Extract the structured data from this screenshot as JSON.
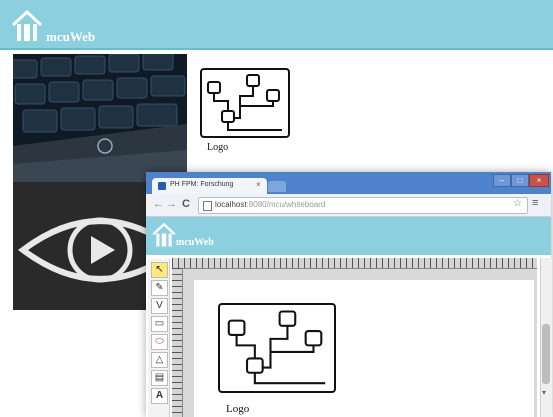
{
  "app": {
    "title": "mcuWeb"
  },
  "logo": {
    "caption": "Logo"
  },
  "browser": {
    "tab_title": "PH FPM: Forschung",
    "tab_close": "×",
    "url_host": "localhost",
    "url_rest": ":8080/mcu/whiteboard",
    "back": "←",
    "forward": "→",
    "reload": "C",
    "star": "☆",
    "menu": "≡",
    "win_min": "–",
    "win_max": "□",
    "win_close": "×"
  },
  "inner_app": {
    "title": "mcuWeb",
    "logo_caption": "Logo",
    "tools": {
      "pointer": "↖",
      "pen": "✎",
      "pencil": "V",
      "rect": "▭",
      "ellipse": "⬭",
      "shape": "△",
      "layers": "▤",
      "text": "A"
    },
    "scroll_down": "▾"
  },
  "colors": {
    "header": "#8ccfdf",
    "tab_strip": "#4e83cb"
  },
  "icons": [
    "home-icon",
    "page-icon",
    "star-icon",
    "menu-icon",
    "close-icon"
  ]
}
